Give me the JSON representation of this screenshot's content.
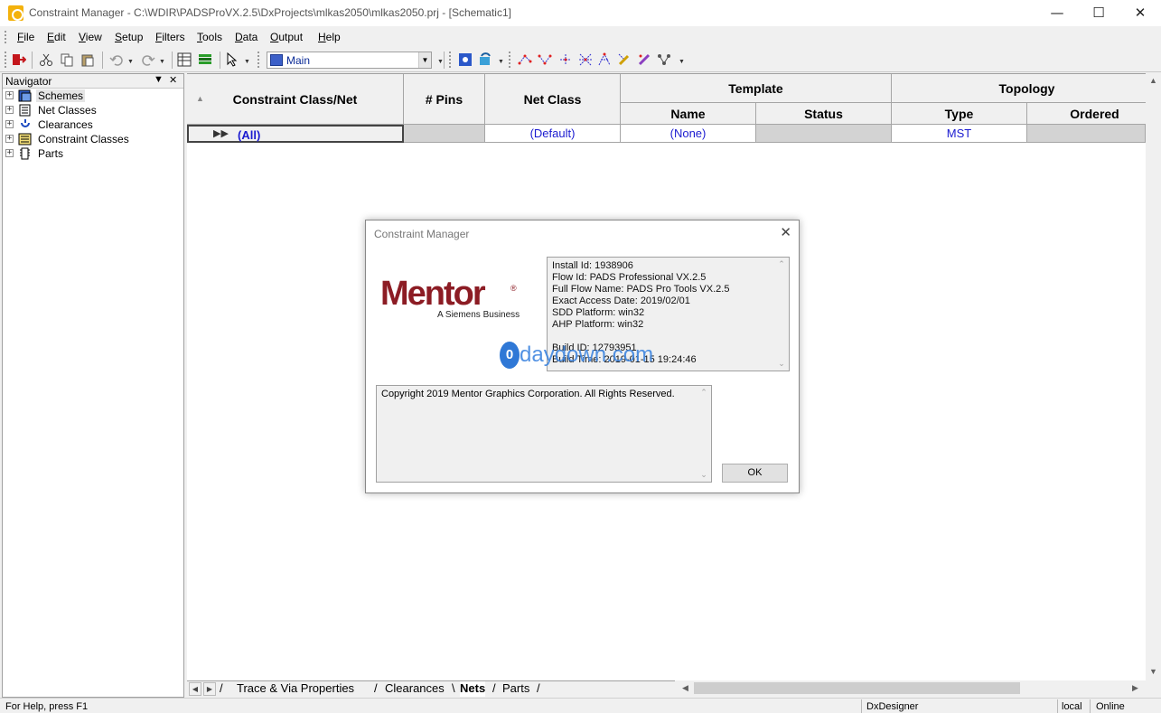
{
  "window": {
    "title": "Constraint Manager - C:\\WDIR\\PADSProVX.2.5\\DxProjects\\mlkas2050\\mlkas2050.prj - [Schematic1]",
    "minimize": "—",
    "maximize": "☐",
    "close": "✕"
  },
  "menu": [
    "File",
    "Edit",
    "View",
    "Setup",
    "Filters",
    "Tools",
    "Data",
    "Output",
    "Help"
  ],
  "toolbar": {
    "scheme_value": "Main"
  },
  "navigator": {
    "title": "Navigator",
    "pin": "▼",
    "close": "✕",
    "items": [
      {
        "label": "Schemes",
        "icon": "schemes-icon"
      },
      {
        "label": "Net Classes",
        "icon": "net-classes-icon"
      },
      {
        "label": "Clearances",
        "icon": "clearances-icon"
      },
      {
        "label": "Constraint Classes",
        "icon": "constraint-classes-icon"
      },
      {
        "label": "Parts",
        "icon": "parts-icon"
      }
    ]
  },
  "grid": {
    "headers": {
      "class_net": "Constraint Class/Net",
      "pins": "# Pins",
      "net_class": "Net Class",
      "template": "Template",
      "topology": "Topology",
      "name": "Name",
      "status": "Status",
      "type": "Type",
      "ordered": "Ordered"
    },
    "row": {
      "class_net": "(All)",
      "pins": "",
      "net_class": "(Default)",
      "name": "(None)",
      "status": "",
      "type": "MST",
      "ordered": ""
    }
  },
  "tabs": {
    "trace": "Trace & Via Properties",
    "clearances": "Clearances",
    "nets": "Nets",
    "parts": "Parts"
  },
  "status": {
    "help": "For Help, press F1",
    "app": "DxDesigner",
    "mode": "local",
    "online": "Online"
  },
  "dialog": {
    "title": "Constraint Manager",
    "close": "✕",
    "logo_word": "Mentor",
    "logo_reg": "®",
    "logo_sub": "A Siemens Business",
    "info_lines": [
      "Install Id: 1938906",
      "Flow Id: PADS Professional VX.2.5",
      "Full Flow Name: PADS Pro Tools VX.2.5",
      "Exact Access Date: 2019/02/01",
      "SDD Platform: win32",
      "AHP Platform: win32",
      "",
      "Build ID: 12793951",
      "Build Time: 2019-01-15 19:24:46"
    ],
    "copyright": "Copyright 2019 Mentor Graphics Corporation.  All Rights Reserved.",
    "ok": "OK",
    "watermark_badge": "0",
    "watermark_text": "daydown.com"
  }
}
